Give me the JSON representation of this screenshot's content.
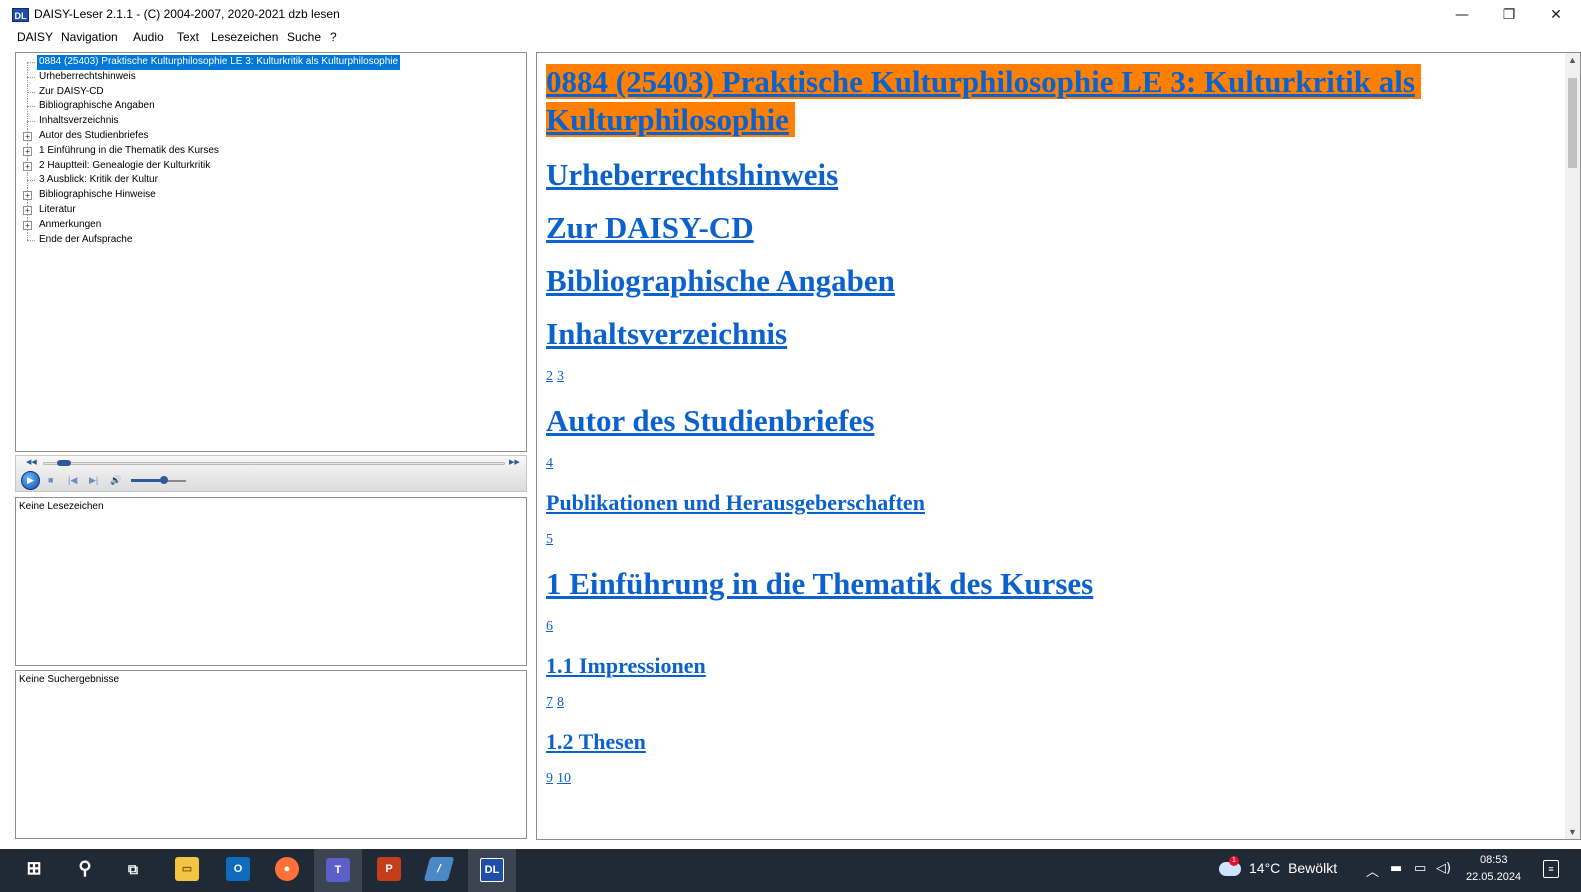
{
  "window": {
    "title": "DAISY-Leser 2.1.1 - (C) 2004-2007, 2020-2021 dzb lesen",
    "app_icon_text": "DL",
    "minimize": "—",
    "restore": "❐",
    "close": "✕"
  },
  "menu": [
    "DAISY",
    "Navigation",
    "Audio",
    "Text",
    "Lesezeichen",
    "Suche",
    "?"
  ],
  "toc": [
    {
      "label": "0884 (25403) Praktische Kulturphilosophie LE 3: Kulturkritik als Kulturphilosophie",
      "expandable": false,
      "selected": true
    },
    {
      "label": "Urheberrechtshinweis",
      "expandable": false
    },
    {
      "label": "Zur DAISY-CD",
      "expandable": false
    },
    {
      "label": "Bibliographische Angaben",
      "expandable": false
    },
    {
      "label": "Inhaltsverzeichnis",
      "expandable": false
    },
    {
      "label": "Autor des Studienbriefes",
      "expandable": true
    },
    {
      "label": "1 Einführung in die Thematik des Kurses",
      "expandable": true
    },
    {
      "label": "2 Hauptteil: Genealogie der Kulturkritik",
      "expandable": true
    },
    {
      "label": "3 Ausblick: Kritik der Kultur",
      "expandable": false
    },
    {
      "label": "Bibliographische Hinweise",
      "expandable": true
    },
    {
      "label": "Literatur",
      "expandable": true
    },
    {
      "label": "Anmerkungen",
      "expandable": true
    },
    {
      "label": "Ende der Aufsprache",
      "expandable": false
    }
  ],
  "player": {
    "position_fraction": 0.03,
    "volume_fraction": 0.6,
    "icons": [
      "play-icon",
      "stop-icon",
      "previous-icon",
      "next-icon",
      "volume-icon"
    ]
  },
  "bookmarks": {
    "empty_text": "Keine Lesezeichen"
  },
  "search": {
    "empty_text": "Keine Suchergebnisse"
  },
  "content": {
    "title_line1": "0884 (25403) Praktische Kulturphilosophie LE 3: Kulturkritik als",
    "title_line2": "Kulturphilosophie",
    "h_urheber": "Urheberrechtshinweis",
    "h_daisy": "Zur DAISY-CD",
    "h_biblio": "Bibliographische Angaben",
    "h_inhalt": "Inhaltsverzeichnis",
    "pages_1": [
      "2",
      "3"
    ],
    "h_autor": "Autor des Studienbriefes",
    "pages_2": [
      "4"
    ],
    "h_publ": "Publikationen und Herausgeberschaften",
    "pages_3": [
      "5"
    ],
    "h_einf": "1 Einführung in die Thematik des Kurses",
    "pages_4": [
      "6"
    ],
    "h_impr": "1.1 Impressionen",
    "pages_5": [
      "7",
      "8"
    ],
    "h_thesen": "1.2 Thesen",
    "pages_6": [
      "9",
      "10"
    ]
  },
  "taskbar": {
    "weather_temp": "14°C",
    "weather_text": "Bewölkt",
    "weather_badge": "1",
    "time": "08:53",
    "date": "22.05.2024",
    "apps": [
      "windows-start-icon",
      "search-icon",
      "task-view-icon",
      "file-explorer-icon",
      "outlook-icon",
      "firefox-icon",
      "teams-icon",
      "powerpoint-icon",
      "notes-icon",
      "daisy-reader-icon"
    ]
  },
  "colors": {
    "selection": "#0078d7",
    "current_highlight": "#ff8000",
    "link": "#0b62cf",
    "taskbar": "#202a36"
  }
}
